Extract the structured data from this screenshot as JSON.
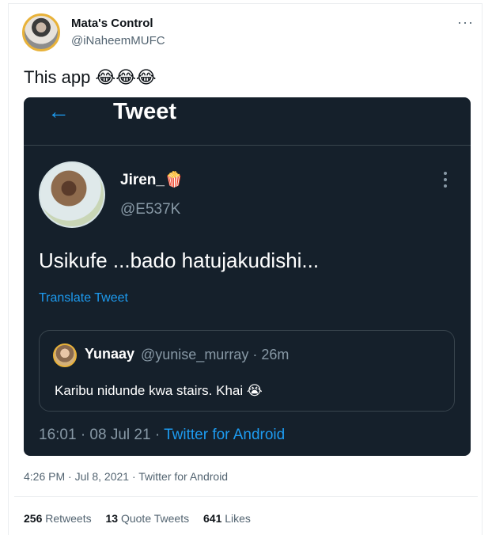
{
  "author": {
    "display_name": "Mata's Control",
    "handle": "@iNaheemMUFC",
    "more_icon": "more-dots-icon",
    "avatar_ring_color": "#e8b23a"
  },
  "tweet": {
    "text": "This app",
    "emojis": "😂😂😂"
  },
  "screenshot": {
    "back_icon": "←",
    "header_title": "Tweet",
    "user_name": "Jiren_",
    "user_emoji": "🍿",
    "user_handle": "@E537K",
    "body": "Usikufe ...bado hatujakudishi...",
    "translate_label": "Translate Tweet",
    "quote": {
      "name": "Yunaay",
      "handle_time": "@yunise_murray · 26m",
      "text": "Karibu nidunde kwa stairs. Khai",
      "emoji": "😭"
    },
    "timestamp": "16:01 · 08 Jul 21 · ",
    "source": "Twitter for Android",
    "bg_color": "#15202b",
    "accent": "#1d9bf0"
  },
  "meta": {
    "time_source": "4:26 PM · Jul 8, 2021 · Twitter for Android"
  },
  "stats": {
    "retweets_count": "256",
    "retweets_label": "Retweets",
    "quotes_count": "13",
    "quotes_label": "Quote Tweets",
    "likes_count": "641",
    "likes_label": "Likes"
  }
}
